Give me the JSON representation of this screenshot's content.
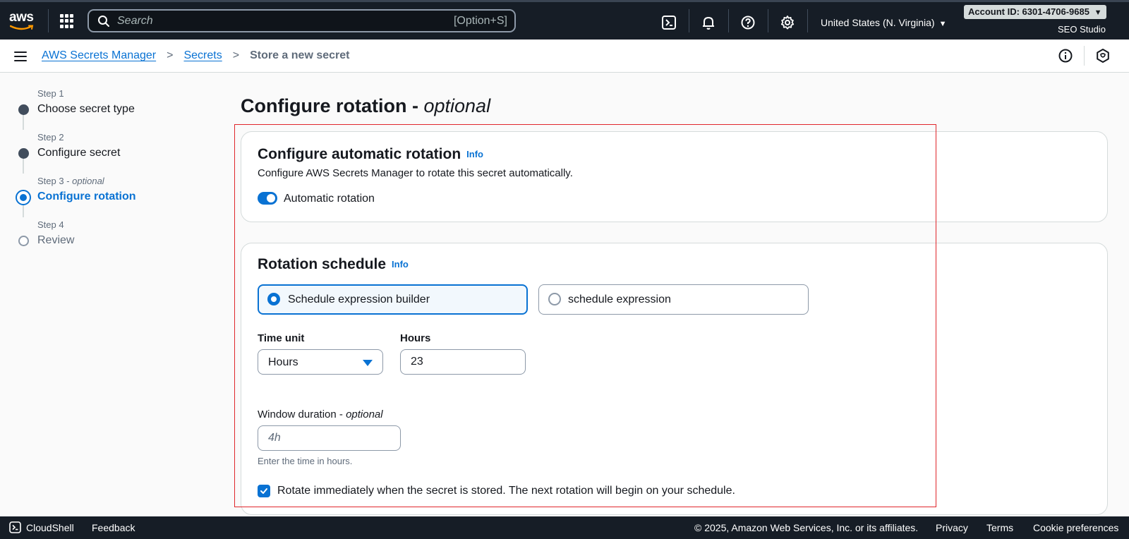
{
  "topbar": {
    "logo_text": "aws",
    "search_placeholder": "Search",
    "search_shortcut": "[Option+S]",
    "region": "United States (N. Virginia)",
    "account": "Account ID: 6301-4706-9685",
    "account_caret": "▼",
    "region_caret": "▼",
    "org": "SEO Studio"
  },
  "breadcrumb": {
    "items": [
      "AWS Secrets Manager",
      "Secrets"
    ],
    "current": "Store a new secret",
    "separator": ">"
  },
  "steps": [
    {
      "num": "Step 1",
      "title": "Choose secret type",
      "state": "done"
    },
    {
      "num": "Step 2",
      "title": "Configure secret",
      "state": "done"
    },
    {
      "num": "Step 3",
      "num_suffix": "optional",
      "title": "Configure rotation",
      "state": "active"
    },
    {
      "num": "Step 4",
      "title": "Review",
      "state": "future"
    }
  ],
  "page": {
    "title": "Configure rotation -",
    "title_suffix": "optional"
  },
  "auto_rotation": {
    "heading": "Configure automatic rotation",
    "info": "Info",
    "description": "Configure AWS Secrets Manager to rotate this secret automatically.",
    "toggle_label": "Automatic rotation",
    "toggle_on": true
  },
  "schedule": {
    "heading": "Rotation schedule",
    "info": "Info",
    "option_builder": "Schedule expression builder",
    "option_expression": "schedule expression",
    "selected": "builder",
    "time_unit_label": "Time unit",
    "time_unit_value": "Hours",
    "hours_label": "Hours",
    "hours_value": "23",
    "window_label": "Window duration -",
    "window_label_suffix": "optional",
    "window_placeholder": "4h",
    "window_hint": "Enter the time in hours.",
    "rotate_immediately": "Rotate immediately when the secret is stored. The next rotation will begin on your schedule.",
    "rotate_checked": true
  },
  "footer": {
    "cloudshell": "CloudShell",
    "feedback": "Feedback",
    "copyright": "© 2025, Amazon Web Services, Inc. or its affiliates.",
    "privacy": "Privacy",
    "terms": "Terms",
    "cookies": "Cookie preferences"
  },
  "colors": {
    "nav_bg": "#161d26",
    "accent": "#0972d3",
    "highlight": "#e0262b"
  }
}
